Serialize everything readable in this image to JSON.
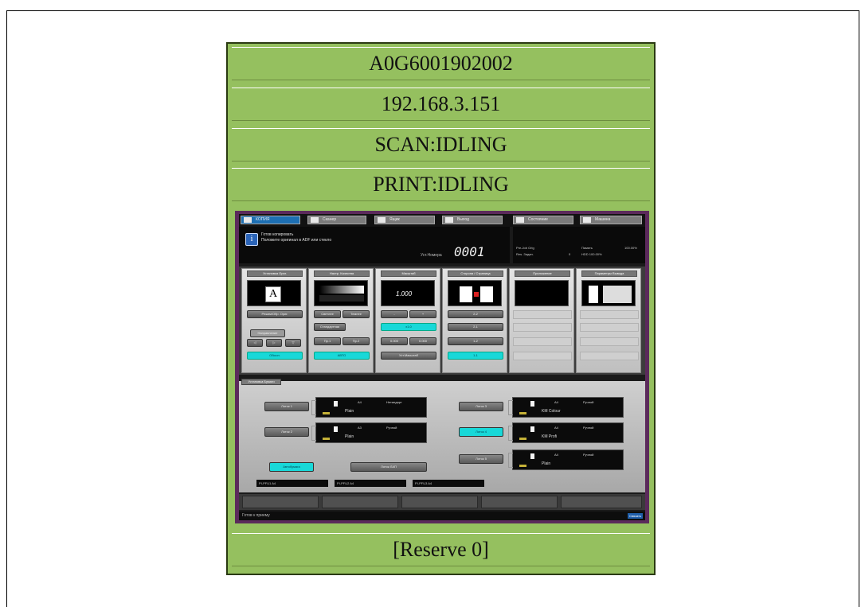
{
  "header": {
    "device_id": "A0G6001902002",
    "ip_address": "192.168.3.151",
    "scan_status": "SCAN:IDLING",
    "print_status": "PRINT:IDLING",
    "reserve": "[Reserve 0]"
  },
  "colors": {
    "panel": "#95c05f",
    "screen_border": "#5b2a5b",
    "accent_cyan": "#18d8d8",
    "tab_active": "#1d6fb3"
  },
  "screen": {
    "tabs": [
      "КОПИЯ",
      "Сканер",
      "Ящик",
      "Выход",
      "Состояние",
      "Машина"
    ],
    "message_line1": "Готов копировать",
    "message_line2": "Положите оригинал в ADF или стекло",
    "counter_label": "Уст.Номера",
    "counter_value": "0001",
    "info": [
      [
        "Pre-Job Orig",
        "Память",
        "100.00%"
      ],
      [
        "Res. Задан.",
        "0",
        "HDD 100.00%"
      ]
    ],
    "columns": [
      {
        "header": "Установка Ориг.",
        "buttons": [
          "Режим/Обр. Ориг.",
          "Направление",
          "Обычн."
        ]
      },
      {
        "header": "Настр. Качества",
        "buttons": [
          "Светлее",
          "Темнее",
          "Стандартная",
          "Пр.1",
          "Пр.2",
          "АВТО"
        ]
      },
      {
        "header": "Масштаб",
        "display": "1.000",
        "buttons": [
          "-",
          "+",
          "x1.0",
          "0.000",
          "0.000",
          "Уст.Масштаб"
        ]
      },
      {
        "header": "Сторона / Страница",
        "buttons": [
          "2-2",
          "2-1",
          "1-2",
          "1-1"
        ]
      },
      {
        "header": "Приложение",
        "buttons": []
      },
      {
        "header": "Параметры Вывода",
        "buttons": []
      }
    ],
    "paper": {
      "tab_label": "Установка Бумаги",
      "trays": [
        {
          "button": "Лоток 1",
          "size": "A4",
          "kind": "Нетандарт",
          "type": "Plain"
        },
        {
          "button": "Лоток 2",
          "size": "A3",
          "kind": "Ручной",
          "type": "Plain"
        },
        {
          "button": "Лоток 3",
          "size": "A4",
          "kind": "Ручной",
          "type": "KM Colour"
        },
        {
          "button": "Лоток 4",
          "size": "A4",
          "kind": "Ручной",
          "type": "KM Profi"
        },
        {
          "button": "Лоток 5",
          "size": "A4",
          "kind": "Ручной",
          "type": "Plain"
        }
      ],
      "auto_paper": "Автобумага",
      "bypass": "Лоток ЛАП",
      "indicators": [
        "PI-PFU1 A4",
        "PI-PFU2 A4",
        "PI-PFU3 A4"
      ]
    },
    "status_text": "Готов к приему",
    "status_right": "Связать"
  }
}
